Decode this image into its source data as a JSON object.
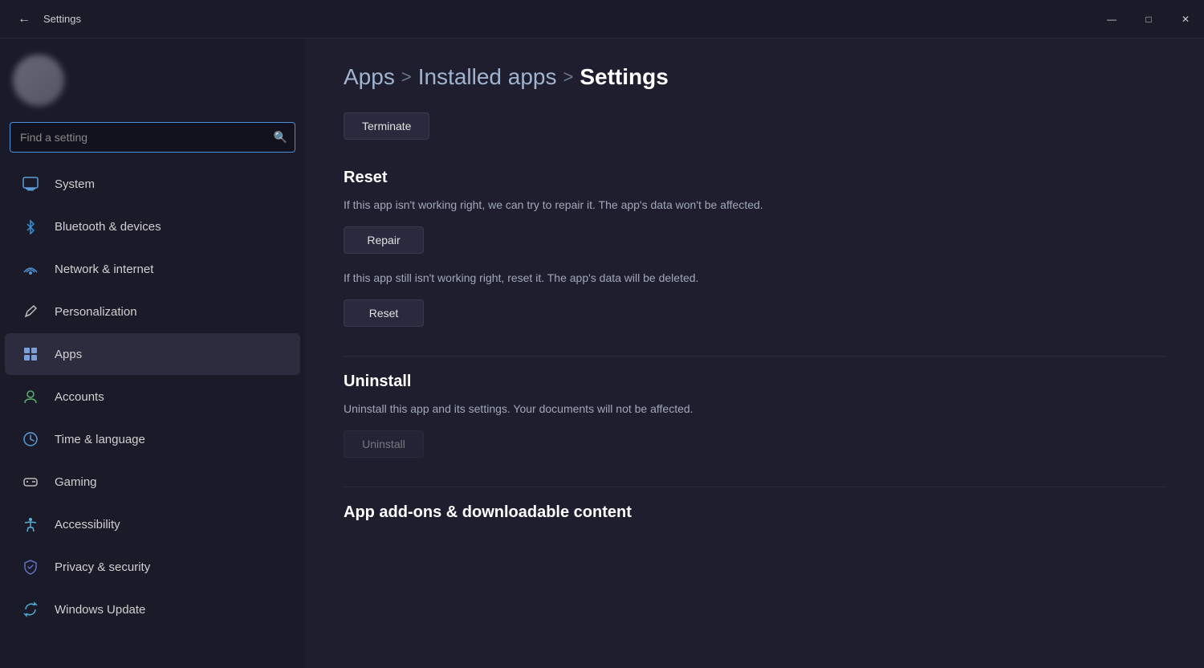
{
  "titlebar": {
    "back_icon": "←",
    "title": "Settings",
    "minimize_icon": "—",
    "maximize_icon": "□",
    "close_icon": "✕"
  },
  "sidebar": {
    "search_placeholder": "Find a setting",
    "items": [
      {
        "id": "system",
        "label": "System",
        "icon": "🖥",
        "icon_class": "icon-system",
        "active": false
      },
      {
        "id": "bluetooth",
        "label": "Bluetooth & devices",
        "icon": "✦",
        "icon_class": "icon-bluetooth",
        "active": false
      },
      {
        "id": "network",
        "label": "Network & internet",
        "icon": "▲",
        "icon_class": "icon-network",
        "active": false
      },
      {
        "id": "personalization",
        "label": "Personalization",
        "icon": "✏",
        "icon_class": "icon-personalization",
        "active": false
      },
      {
        "id": "apps",
        "label": "Apps",
        "icon": "⊞",
        "icon_class": "icon-apps",
        "active": true
      },
      {
        "id": "accounts",
        "label": "Accounts",
        "icon": "👤",
        "icon_class": "icon-accounts",
        "active": false
      },
      {
        "id": "time",
        "label": "Time & language",
        "icon": "⏱",
        "icon_class": "icon-time",
        "active": false
      },
      {
        "id": "gaming",
        "label": "Gaming",
        "icon": "🎮",
        "icon_class": "icon-gaming",
        "active": false
      },
      {
        "id": "accessibility",
        "label": "Accessibility",
        "icon": "♿",
        "icon_class": "icon-accessibility",
        "active": false
      },
      {
        "id": "privacy",
        "label": "Privacy & security",
        "icon": "🛡",
        "icon_class": "icon-privacy",
        "active": false
      },
      {
        "id": "update",
        "label": "Windows Update",
        "icon": "↻",
        "icon_class": "icon-update",
        "active": false
      }
    ]
  },
  "content": {
    "breadcrumb": {
      "apps": "Apps",
      "sep1": ">",
      "installed": "Installed apps",
      "sep2": ">",
      "current": "Settings"
    },
    "terminate_btn": "Terminate",
    "reset_section": {
      "title": "Reset",
      "description1": "If this app isn't working right, we can try to repair it. The app's data won't be affected.",
      "repair_btn": "Repair",
      "description2": "If this app still isn't working right, reset it. The app's data will be deleted.",
      "reset_btn": "Reset"
    },
    "uninstall_section": {
      "title": "Uninstall",
      "description": "Uninstall this app and its settings. Your documents will not be affected.",
      "uninstall_btn": "Uninstall"
    },
    "addons_section": {
      "title": "App add-ons & downloadable content"
    }
  }
}
